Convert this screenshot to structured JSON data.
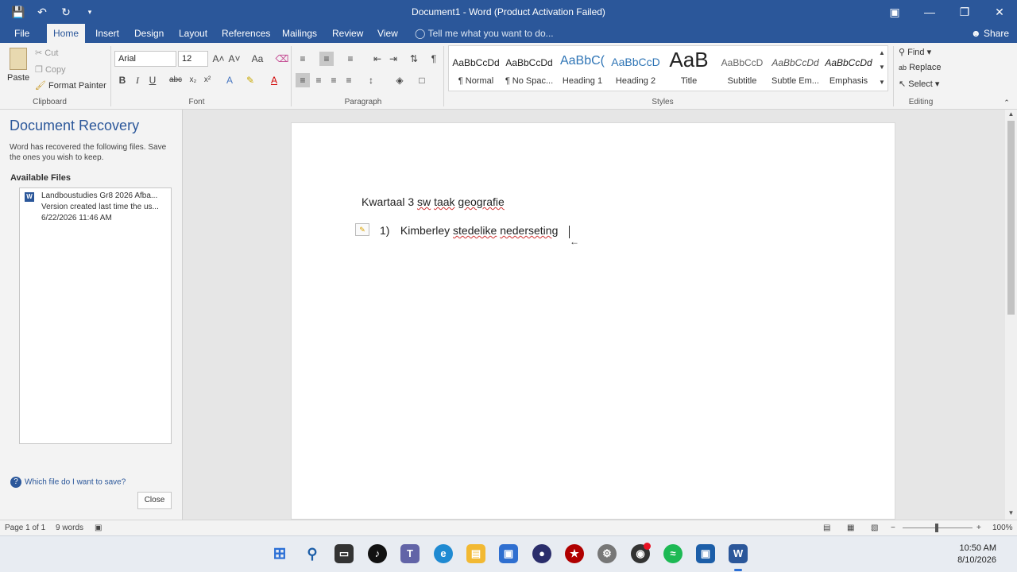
{
  "window": {
    "title": "Document1 - Word (Product Activation Failed)",
    "qat": {
      "save_icon": "save-icon",
      "undo_icon": "undo-icon",
      "redo_icon": "redo-icon"
    }
  },
  "tabs": [
    {
      "label": "File"
    },
    {
      "label": "Home"
    },
    {
      "label": "Insert"
    },
    {
      "label": "Design"
    },
    {
      "label": "Layout"
    },
    {
      "label": "References"
    },
    {
      "label": "Mailings"
    },
    {
      "label": "Review"
    },
    {
      "label": "View"
    }
  ],
  "tell_me": "Tell me what you want to do...",
  "share": "Share",
  "ribbon": {
    "clipboard": {
      "paste": "Paste",
      "cut": "Cut",
      "copy": "Copy",
      "format_painter": "Format Painter",
      "label": "Clipboard"
    },
    "font": {
      "family": "Arial",
      "size": "12",
      "label": "Font"
    },
    "paragraph": {
      "label": "Paragraph"
    },
    "styles": {
      "label": "Styles",
      "items": [
        {
          "sample": "AaBbCcDd",
          "name": "¶ Normal"
        },
        {
          "sample": "AaBbCcDd",
          "name": "¶ No Spac..."
        },
        {
          "sample": "AaBbC(",
          "name": "Heading 1"
        },
        {
          "sample": "AaBbCcD",
          "name": "Heading 2"
        },
        {
          "sample": "AaB",
          "name": "Title"
        },
        {
          "sample": "AaBbCcD",
          "name": "Subtitle"
        },
        {
          "sample": "AaBbCcDd",
          "name": "Subtle Em..."
        },
        {
          "sample": "AaBbCcDd",
          "name": "Emphasis"
        }
      ]
    },
    "editing": {
      "find": "Find",
      "replace": "Replace",
      "select": "Select",
      "label": "Editing"
    }
  },
  "recovery": {
    "heading": "Document Recovery",
    "description": "Word has recovered the following files.  Save the ones you wish to keep.",
    "available_label": "Available Files",
    "file": {
      "name": "Landboustudies Gr8 2026 Afba...",
      "version": "Version created last time the us...",
      "date": "6/22/2026 11:46 AM"
    },
    "help_link": "Which file do I want to save?",
    "close": "Close"
  },
  "document": {
    "heading_words": [
      "Kwartaal 3",
      "sw",
      "taak",
      "geografie"
    ],
    "list_number": "1)",
    "list_words": [
      "Kimberley",
      "stedelike",
      "nederseting"
    ]
  },
  "status": {
    "page": "Page 1 of 1",
    "words": "9 words",
    "zoom": "100%"
  },
  "taskbar": {
    "time": "10:50 AM",
    "date": "8/10/2026",
    "colors": {
      "accent": "#2b579a",
      "spotify": "#1db954",
      "opera_red": "#d0021b"
    }
  }
}
